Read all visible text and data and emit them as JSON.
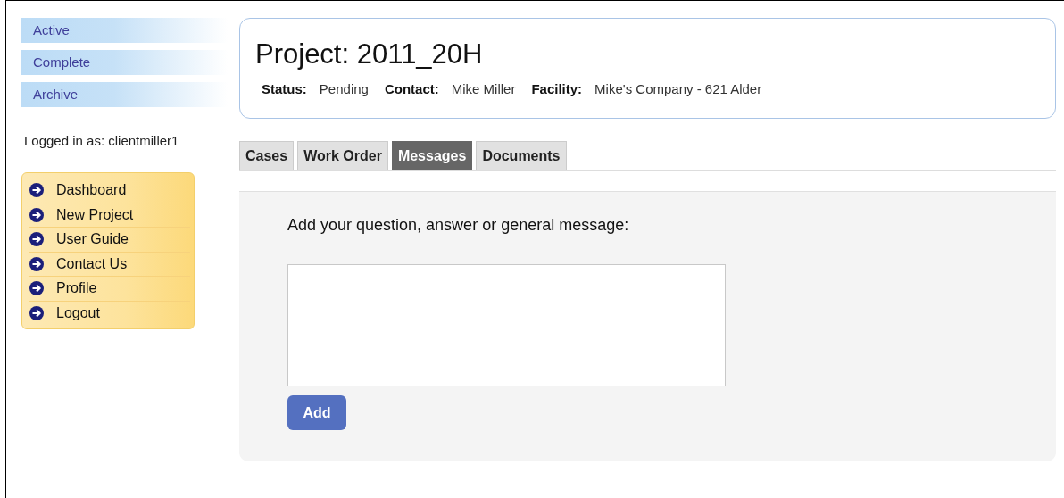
{
  "status_links": [
    {
      "label": "Active"
    },
    {
      "label": "Complete"
    },
    {
      "label": "Archive"
    }
  ],
  "logged_in": "Logged in as: clientmiller1",
  "menu": [
    {
      "label": "Dashboard"
    },
    {
      "label": "New Project"
    },
    {
      "label": "User Guide"
    },
    {
      "label": "Contact Us"
    },
    {
      "label": "Profile"
    },
    {
      "label": "Logout"
    }
  ],
  "project": {
    "title": "Project: 2011_20H",
    "fields": [
      {
        "label": "Status:",
        "value": "Pending"
      },
      {
        "label": "Contact:",
        "value": "Mike Miller"
      },
      {
        "label": "Facility:",
        "value": "Mike's Company - 621 Alder"
      }
    ]
  },
  "tabs": [
    {
      "label": "Cases",
      "selected": false
    },
    {
      "label": "Work Order",
      "selected": false
    },
    {
      "label": "Messages",
      "selected": true
    },
    {
      "label": "Documents",
      "selected": false
    }
  ],
  "message_form": {
    "prompt": "Add your question, answer or general message:",
    "button": "Add"
  }
}
